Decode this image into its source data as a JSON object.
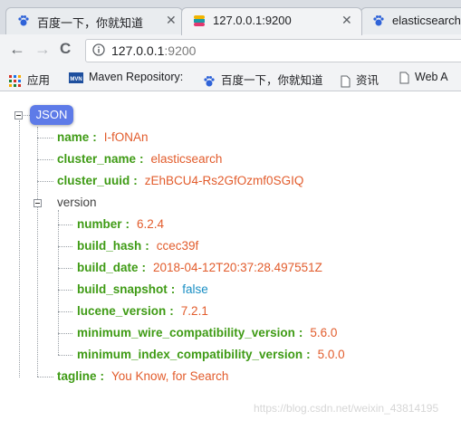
{
  "tabs": [
    {
      "title": "百度一下，你就知道",
      "icon": "baidu-paw-icon"
    },
    {
      "title": "127.0.0.1:9200",
      "icon": "elastic-icon"
    },
    {
      "title": "elasticsearch",
      "icon": "baidu-paw-icon"
    }
  ],
  "toolbar": {
    "back_icon": "←",
    "forward_icon": "→",
    "reload_icon": "C",
    "url_host": "127.0.0.1",
    "url_port": ":9200"
  },
  "bookmarks": [
    {
      "label": "应用",
      "icon": "apps-grid-icon"
    },
    {
      "label": "Maven Repository:",
      "icon": "mvn-logo-icon"
    },
    {
      "label": "百度一下，你就知道",
      "icon": "baidu-paw-icon"
    },
    {
      "label": "资讯",
      "icon": "page-icon"
    },
    {
      "label": "Web A",
      "icon": "page-icon"
    }
  ],
  "json_viewer": {
    "root_label": "JSON",
    "fields": [
      {
        "key": "name",
        "value": "I-fONAn"
      },
      {
        "key": "cluster_name",
        "value": "elasticsearch"
      },
      {
        "key": "cluster_uuid",
        "value": "zEhBCU4-Rs2GfOzmf0SGIQ"
      }
    ],
    "version": {
      "label": "version",
      "fields": [
        {
          "key": "number",
          "value": "6.2.4"
        },
        {
          "key": "build_hash",
          "value": "ccec39f"
        },
        {
          "key": "build_date",
          "value": "2018-04-12T20:37:28.497551Z"
        },
        {
          "key": "build_snapshot",
          "value": "false"
        },
        {
          "key": "lucene_version",
          "value": "7.2.1"
        },
        {
          "key": "minimum_wire_compatibility_version",
          "value": "5.6.0"
        },
        {
          "key": "minimum_index_compatibility_version",
          "value": "5.0.0"
        }
      ]
    },
    "tagline": {
      "key": "tagline",
      "value": "You Know, for Search"
    },
    "separator": ":"
  },
  "watermark": "https://blog.csdn.net/weixin_43814195"
}
